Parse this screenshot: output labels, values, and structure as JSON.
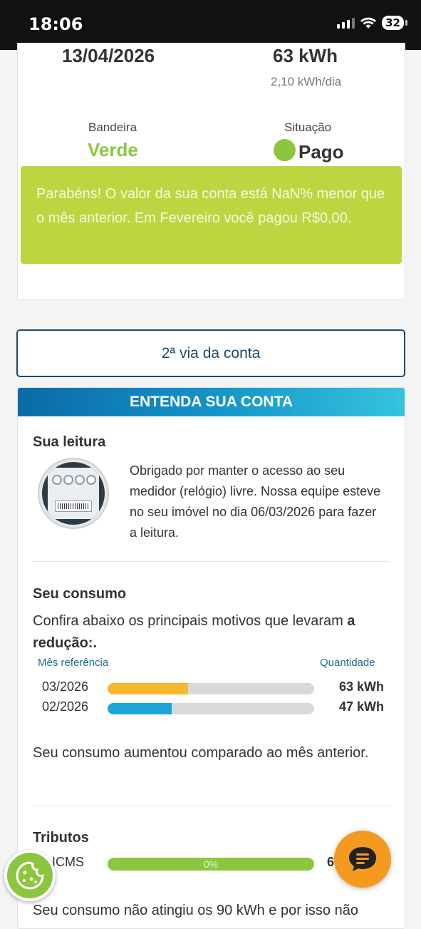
{
  "status_bar": {
    "time": "18:06",
    "battery": "32"
  },
  "summary": {
    "date": "13/04/2026",
    "consumption": "63 kWh",
    "per_day": "2,10 kWh/dia",
    "flag_label": "Bandeira",
    "flag_value": "Verde",
    "status_label": "Situação",
    "status_value": "Pago",
    "congrats": "Parabéns! O valor da sua conta está NaN% menor que o mês anterior. Em Fevereiro você pagou R$0,00."
  },
  "second_copy_button": "2ª via da conta",
  "understand": {
    "header": "ENTENDA SUA CONTA",
    "reading_title": "Sua leitura",
    "reading_text": "Obrigado por manter o acesso ao seu medidor (relógio) livre. Nossa equipe esteve no seu imóvel no dia 06/03/2026 para fazer a leitura.",
    "consumption_title": "Seu consumo",
    "consumption_intro": "Confira abaixo os principais motivos que levaram",
    "consumption_intro_bold": "a redução:.",
    "col_month": "Mês referência",
    "col_quantity": "Quantidade",
    "rows": [
      {
        "month": "03/2026",
        "quantity": "63 kWh",
        "fraction": 0.39,
        "color": "#f5b82e"
      },
      {
        "month": "02/2026",
        "quantity": "47 kWh",
        "fraction": 0.31,
        "color": "#1ea5d8"
      }
    ],
    "consumption_note": "Seu consumo aumentou comparado ao mês anterior.",
    "taxes_title": "Tributos",
    "icms_label": "ICMS",
    "icms_percent": "0%",
    "icms_value": "6",
    "icms_note": "Seu consumo não atingiu os 90 kWh e por isso não"
  }
}
